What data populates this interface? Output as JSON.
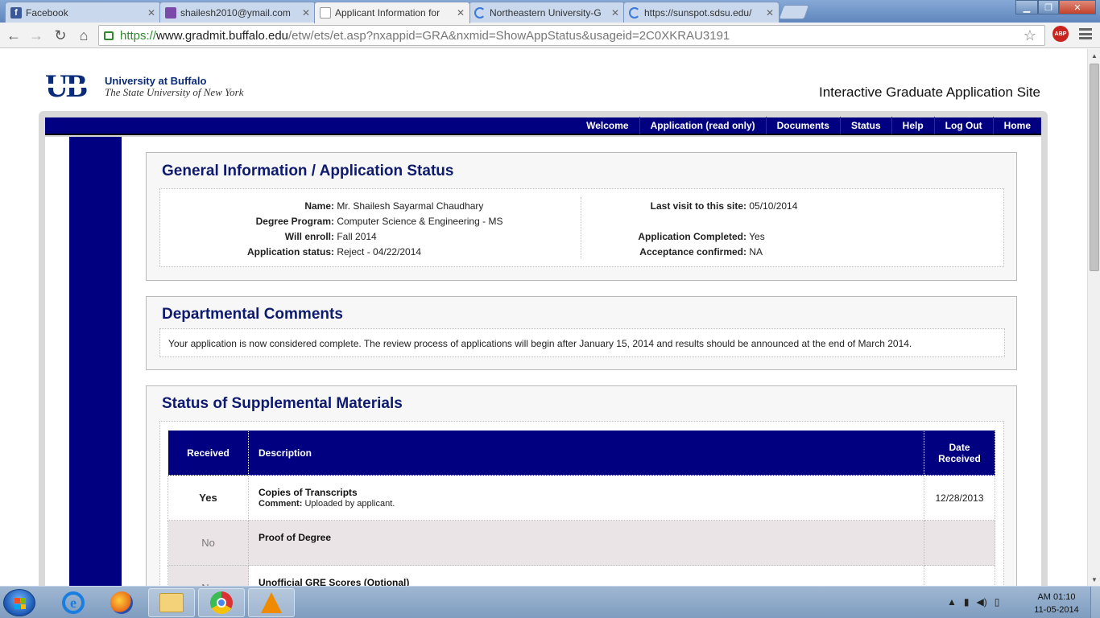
{
  "browser": {
    "tabs": [
      {
        "title": "Facebook",
        "icon": "facebook-icon",
        "color": "#3b5998"
      },
      {
        "title": "shailesh2010@ymail.com",
        "icon": "mail-icon",
        "color": "#7b4aa8"
      },
      {
        "title": "Applicant Information for",
        "icon": "page-icon",
        "color": "#ffffff"
      },
      {
        "title": "Northeastern University-G",
        "icon": "loading-icon",
        "color": "#3a79d6"
      },
      {
        "title": "https://sunspot.sdsu.edu/",
        "icon": "loading-icon",
        "color": "#3a79d6"
      }
    ],
    "url": {
      "scheme": "https://",
      "host": "www.gradmit.buffalo.edu",
      "path": "/etw/ets/et.asp?nxappid=GRA&nxmid=ShowAppStatus&usageid=2C0XKRAU3191"
    },
    "abp_label": "ABP"
  },
  "header": {
    "university_name": "University at Buffalo",
    "university_sub": "The State University of New York",
    "logo_letters": {
      "u": "U",
      "b": "B"
    },
    "site_title": "Interactive Graduate Application Site"
  },
  "nav": {
    "items": [
      "Welcome",
      "Application (read only)",
      "Documents",
      "Status",
      "Help",
      "Log Out",
      "Home"
    ]
  },
  "general": {
    "heading": "General Information / Application Status",
    "left": [
      {
        "label": "Name:",
        "value": "Mr. Shailesh Sayarmal Chaudhary"
      },
      {
        "label": "Degree Program:",
        "value": "Computer Science & Engineering - MS"
      },
      {
        "label": "Will enroll:",
        "value": "Fall 2014"
      },
      {
        "label": "Application status:",
        "value": "Reject - 04/22/2014"
      }
    ],
    "right": [
      {
        "label": "Last visit to this site:",
        "value": "05/10/2014"
      },
      {
        "label": "Application Completed:",
        "value": "Yes"
      },
      {
        "label": "Acceptance confirmed:",
        "value": "NA"
      }
    ]
  },
  "comments": {
    "heading": "Departmental Comments",
    "text": "Your application is now considered complete. The review process of applications will begin after January 15, 2014 and results should be announced at the end of March 2014."
  },
  "supplemental": {
    "heading": "Status of Supplemental Materials",
    "columns": {
      "received": "Received",
      "description": "Description",
      "date": "Date Received"
    },
    "rows": [
      {
        "received": "Yes",
        "title": "Copies of Transcripts",
        "comment_label": "Comment:",
        "comment": "Uploaded by applicant.",
        "date": "12/28/2013"
      },
      {
        "received": "No",
        "title": "Proof of Degree",
        "comment_label": "",
        "comment": "",
        "date": ""
      },
      {
        "received": "No",
        "title": "Unofficial GRE Scores (Optional)",
        "comment_label": "",
        "comment": "",
        "date": ""
      }
    ]
  },
  "taskbar": {
    "clock_time": "AM 01:10",
    "clock_date": "11-05-2014"
  }
}
